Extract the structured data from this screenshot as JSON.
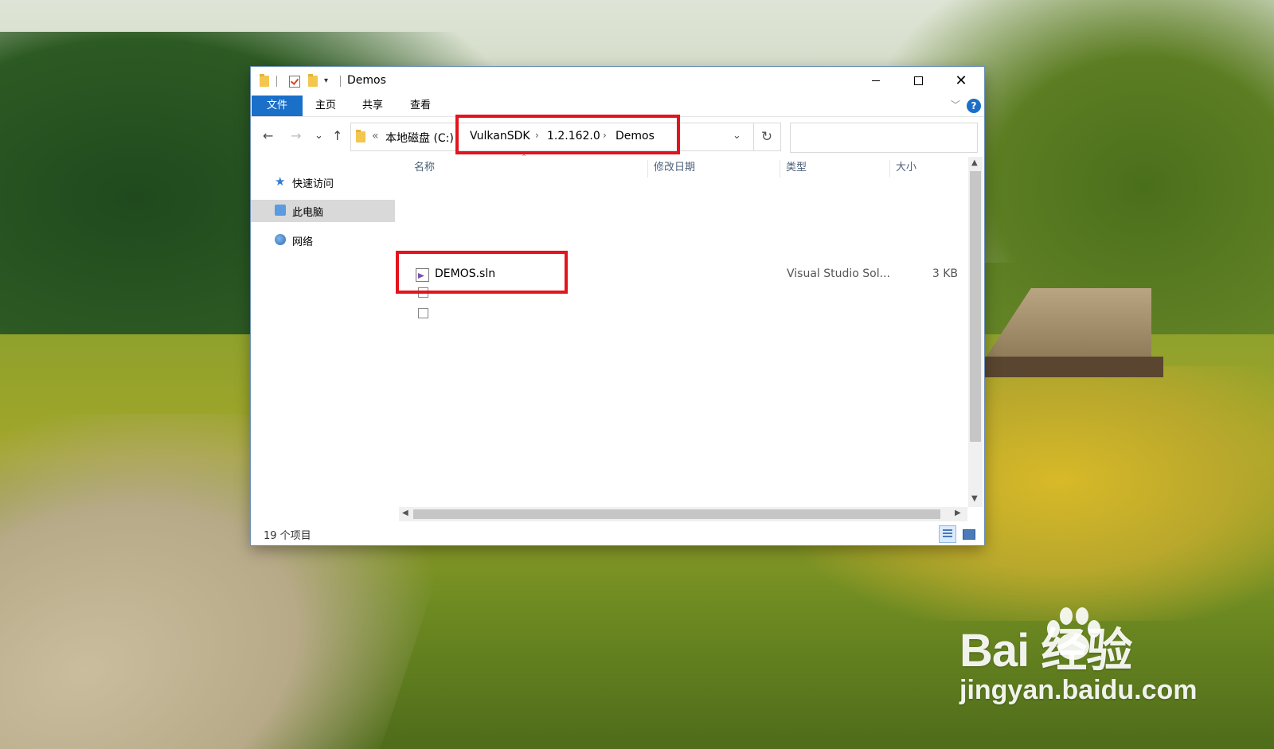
{
  "window": {
    "title": "Demos",
    "qat_dropdown": "▾",
    "controls": {
      "minimize": "—",
      "maximize": "☐",
      "close": "✕"
    }
  },
  "ribbon": {
    "tabs": [
      "文件",
      "主页",
      "共享",
      "查看"
    ],
    "collapse_glyph": "﹀",
    "help": "?"
  },
  "nav": {
    "back": "←",
    "forward": "→",
    "recent": "⌄",
    "up": "↑"
  },
  "address": {
    "overflow": "«",
    "crumbs": [
      "本地磁盘 (C:)",
      "VulkanSDK",
      "1.2.162.0",
      "Demos"
    ],
    "separator": "›",
    "dropdown": "⌄",
    "refresh": "↻"
  },
  "search": {
    "placeholder": ""
  },
  "sidebar": {
    "items": [
      {
        "label": "快速访问",
        "icon": "star-icon",
        "selected": false
      },
      {
        "label": "此电脑",
        "icon": "computer-icon",
        "selected": true
      },
      {
        "label": "网络",
        "icon": "network-icon",
        "selected": false
      }
    ]
  },
  "columns": [
    "名称",
    "修改日期",
    "类型",
    "大小"
  ],
  "files": [
    {
      "name": "DEMOS.sln",
      "modified": "",
      "type": "Visual Studio Sol...",
      "size": "3 KB",
      "icon": "visual-studio-solution-icon"
    }
  ],
  "status": {
    "item_count": "19 个项目"
  },
  "annotations": {
    "color": "#e3141c"
  },
  "watermark": {
    "logo": "Bai 经验",
    "url": "jingyan.baidu.com"
  },
  "colors": {
    "accent": "#1a6fc9",
    "selection": "#d9d9d9"
  }
}
